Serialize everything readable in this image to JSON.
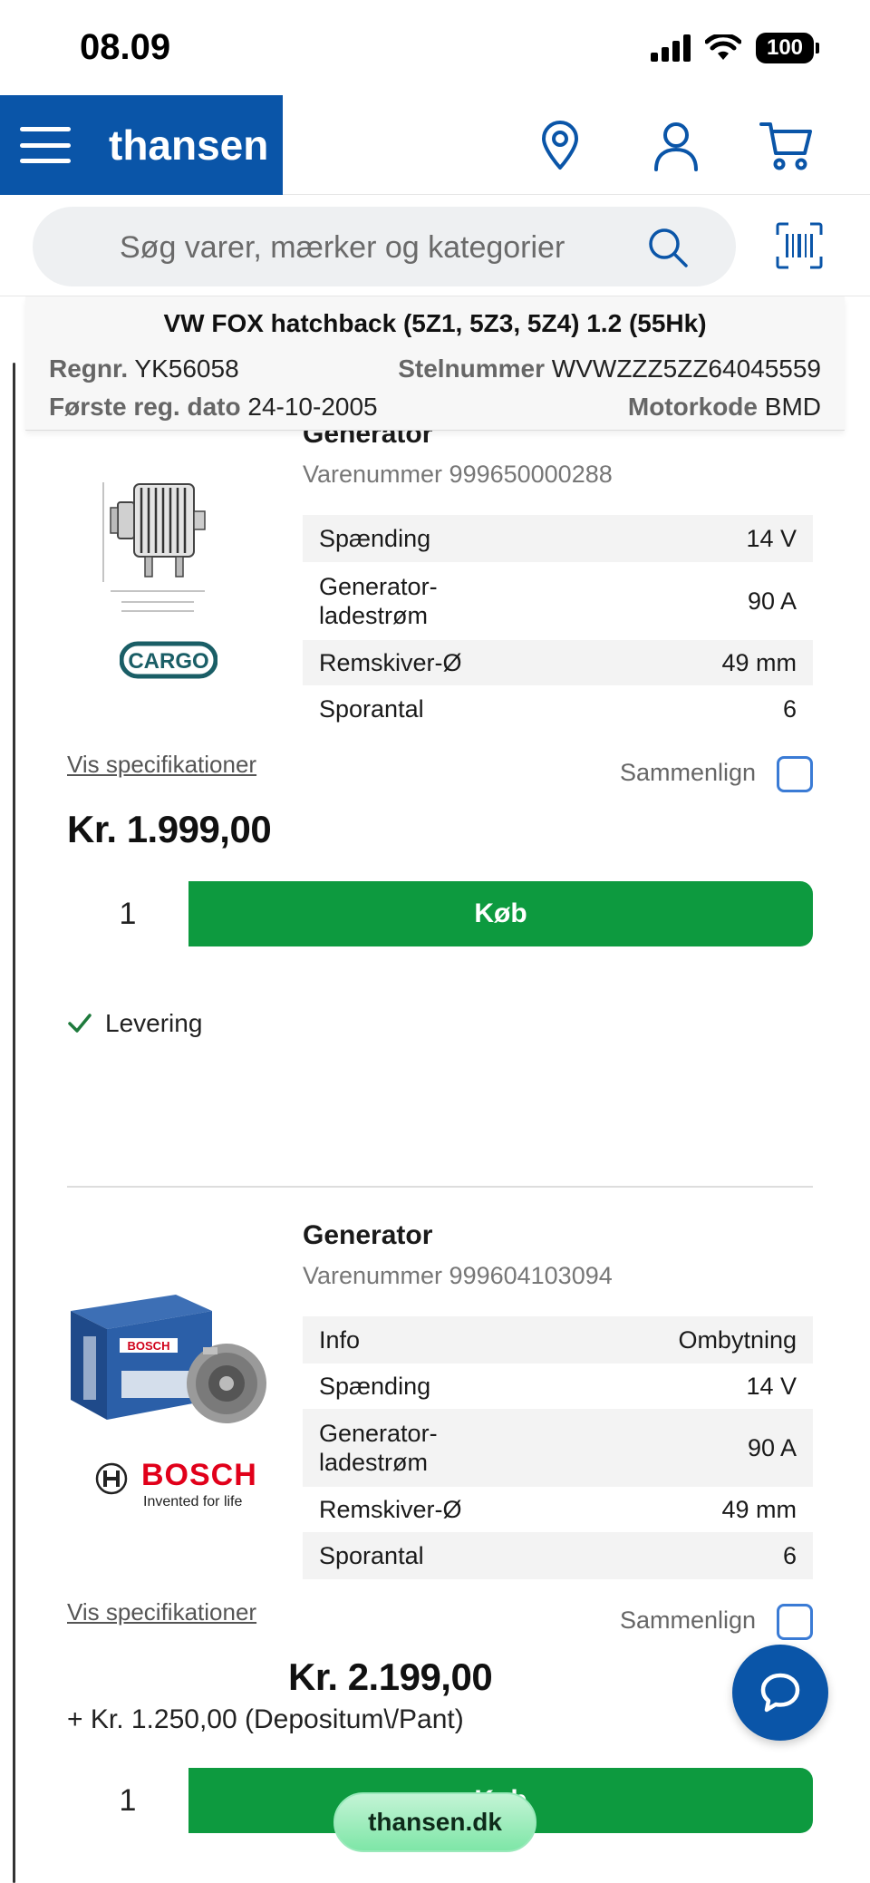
{
  "status_bar": {
    "time": "08.09",
    "battery": "100"
  },
  "header": {
    "logo": "thansen",
    "brand_color": "#0a55a8"
  },
  "search": {
    "placeholder": "Søg varer, mærker og kategorier"
  },
  "vehicle": {
    "title": "VW FOX hatchback (5Z1, 5Z3, 5Z4) 1.2 (55Hk)",
    "regnr_label": "Regnr.",
    "regnr": "YK56058",
    "stelnr_label": "Stelnummer",
    "stelnr": "WVWZZZ5ZZ64045559",
    "first_reg_label": "Første reg. dato",
    "first_reg": "24-10-2005",
    "motorkode_label": "Motorkode",
    "motorkode": "BMD"
  },
  "products": [
    {
      "title": "Generator",
      "varenummer": "Varenummer 999650000288",
      "brand": "CARGO",
      "specs": [
        {
          "k": "Spænding",
          "v": "14 V"
        },
        {
          "k": "Generator-\nladestrøm",
          "v": "90 A"
        },
        {
          "k": "Remskiver-Ø",
          "v": "49 mm"
        },
        {
          "k": "Sporantal",
          "v": "6"
        }
      ],
      "vis_spec": "Vis specifikationer",
      "compare": "Sammenlign",
      "price": "Kr. 1.999,00",
      "qty": "1",
      "buy": "Køb",
      "delivery": "Levering"
    },
    {
      "title": "Generator",
      "varenummer": "Varenummer 999604103094",
      "brand": "BOSCH",
      "brand_tagline": "Invented for life",
      "box_brand": "BOSCH",
      "specs": [
        {
          "k": "Info",
          "v": "Ombytning"
        },
        {
          "k": "Spænding",
          "v": "14 V"
        },
        {
          "k": "Generator-\nladestrøm",
          "v": "90 A"
        },
        {
          "k": "Remskiver-Ø",
          "v": "49 mm"
        },
        {
          "k": "Sporantal",
          "v": "6"
        }
      ],
      "vis_spec": "Vis specifikationer",
      "compare": "Sammenlign",
      "price": "Kr. 2.199,00",
      "deposit": "+ Kr. 1.250,00 (Depositum\\/Pant)",
      "qty": "1",
      "buy": "Køb"
    }
  ],
  "footer": {
    "url": "thansen.dk"
  },
  "colors": {
    "buy_green": "#0d9a3f",
    "accent_blue": "#0a55a8"
  }
}
